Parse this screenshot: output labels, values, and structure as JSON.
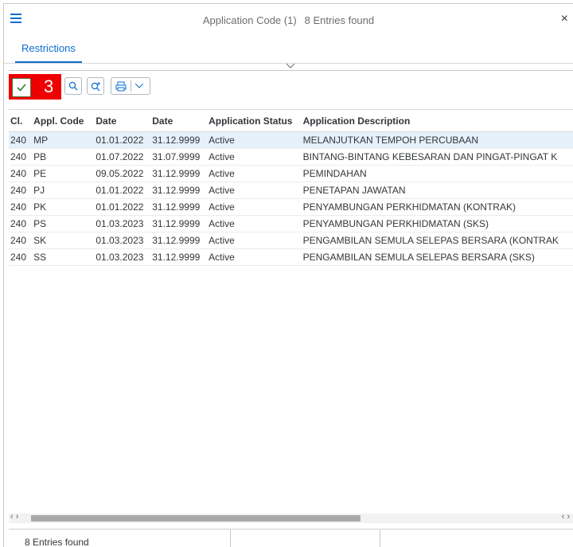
{
  "window": {
    "title": "Application Code (1)",
    "entries_found": "8 Entries found",
    "close_label": "×"
  },
  "tabs": [
    {
      "label": "Restrictions"
    }
  ],
  "toolbar": {
    "step_number": "3"
  },
  "table": {
    "columns": [
      "Cl.",
      "Appl. Code",
      "Date",
      "Date",
      "Application Status",
      "Application Description"
    ],
    "rows": [
      {
        "cl": "240",
        "code": "MP",
        "date_from": "01.01.2022",
        "date_to": "31.12.9999",
        "status": "Active",
        "description": "MELANJUTKAN TEMPOH PERCUBAAN"
      },
      {
        "cl": "240",
        "code": "PB",
        "date_from": "01.07.2022",
        "date_to": "31.07.9999",
        "status": "Active",
        "description": "BINTANG-BINTANG KEBESARAN DAN PINGAT-PINGAT K"
      },
      {
        "cl": "240",
        "code": "PE",
        "date_from": "09.05.2022",
        "date_to": "31.12.9999",
        "status": "Active",
        "description": "PEMINDAHAN"
      },
      {
        "cl": "240",
        "code": "PJ",
        "date_from": "01.01.2022",
        "date_to": "31.12.9999",
        "status": "Active",
        "description": "PENETAPAN JAWATAN"
      },
      {
        "cl": "240",
        "code": "PK",
        "date_from": "01.01.2022",
        "date_to": "31.12.9999",
        "status": "Active",
        "description": "PENYAMBUNGAN PERKHIDMATAN (KONTRAK)"
      },
      {
        "cl": "240",
        "code": "PS",
        "date_from": "01.03.2023",
        "date_to": "31.12.9999",
        "status": "Active",
        "description": "PENYAMBUNGAN PERKHIDMATAN (SKS)"
      },
      {
        "cl": "240",
        "code": "SK",
        "date_from": "01.03.2023",
        "date_to": "31.12.9999",
        "status": "Active",
        "description": "PENGAMBILAN SEMULA SELEPAS BERSARA (KONTRAK"
      },
      {
        "cl": "240",
        "code": "SS",
        "date_from": "01.03.2023",
        "date_to": "31.12.9999",
        "status": "Active",
        "description": "PENGAMBILAN SEMULA SELEPAS BERSARA (SKS)"
      }
    ]
  },
  "status_bar": {
    "text": "8 Entries found"
  },
  "colors": {
    "accent": "#0a6ed1",
    "highlight": "#ee0000",
    "selected_row": "#e5f0fa"
  }
}
